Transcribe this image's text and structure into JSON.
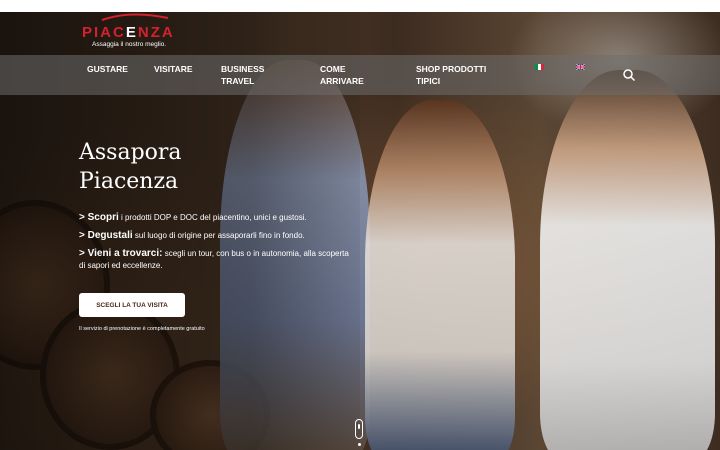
{
  "brand": {
    "logo_red": "PIAC",
    "logo_white": "E",
    "logo_red2": "NZA",
    "tagline": "Assaggia il nostro meglio.",
    "accent_color": "#d4212e"
  },
  "nav": {
    "items": [
      {
        "line1": "GUSTARE",
        "line2": ""
      },
      {
        "line1": "VISITARE",
        "line2": ""
      },
      {
        "line1": "BUSINESS",
        "line2": "TRAVEL"
      },
      {
        "line1": "COME",
        "line2": "ARRIVARE"
      },
      {
        "line1": "SHOP PRODOTTI",
        "line2": "TIPICI"
      }
    ],
    "languages": [
      {
        "name": "italian-flag-icon",
        "code": "it"
      },
      {
        "name": "uk-flag-icon",
        "code": "en"
      }
    ],
    "search_icon": "search-icon"
  },
  "hero": {
    "title_line1": "Assapora",
    "title_line2": "Piacenza",
    "bullets": [
      {
        "lead": "> Scopri",
        "text": " i prodotti DOP e DOC del piacentino, unici e gustosi."
      },
      {
        "lead": "> Degustali",
        "text": " sul luogo di origine per assaporarli fino in fondo."
      },
      {
        "lead": "> Vieni a trovarci:",
        "text": " scegli un tour, con bus o in autonomia, alla scoperta di sapori ed eccellenze."
      }
    ],
    "cta_label": "SCEGLI LA TUA VISITA",
    "note": "Il servizio di prenotazione è completamente gratuito"
  }
}
